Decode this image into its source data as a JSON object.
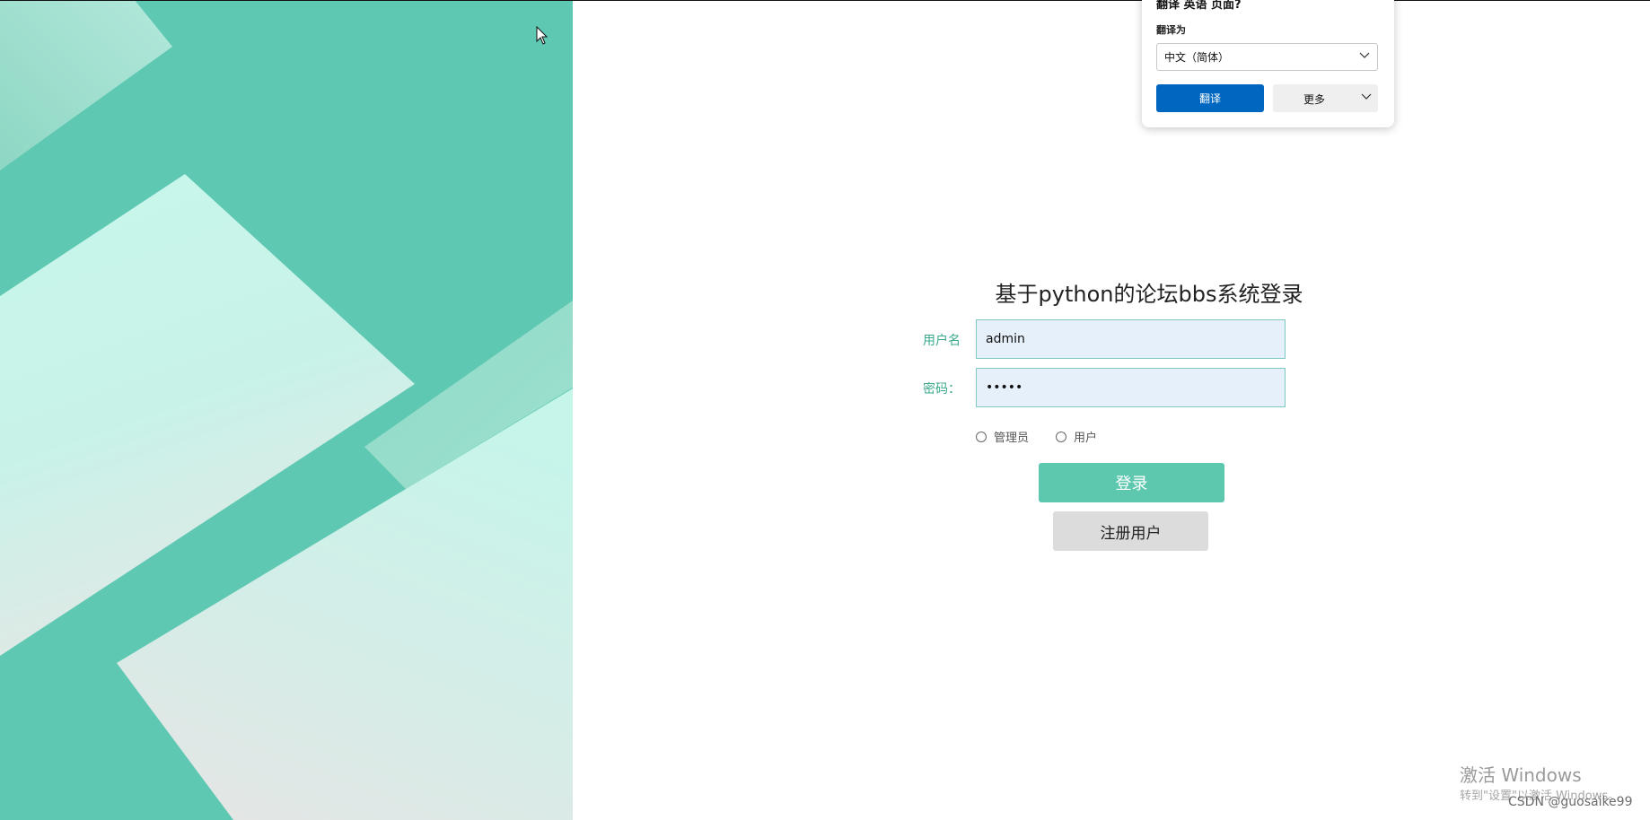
{
  "login": {
    "title": "基于python的论坛bbs系统登录",
    "username_label": "用户名",
    "username_value": "admin",
    "password_label": "密码：",
    "password_value": "•••••",
    "role_options": [
      "管理员",
      "用户"
    ],
    "login_button": "登录",
    "register_button": "注册用户"
  },
  "translate_popup": {
    "question": "翻译 英语 页面?",
    "target_label": "翻译为",
    "target_language": "中文（简体）",
    "translate_button": "翻译",
    "more_button": "更多"
  },
  "watermark": {
    "activate": "激活 Windows",
    "activate_hint": "转到\"设置\"以激活 Windows。",
    "csdn": "CSDN @guosaike99"
  },
  "colors": {
    "accent_green": "#5ec8ae",
    "panel_teal": "#5ec8b2",
    "translate_blue": "#0067c0"
  }
}
